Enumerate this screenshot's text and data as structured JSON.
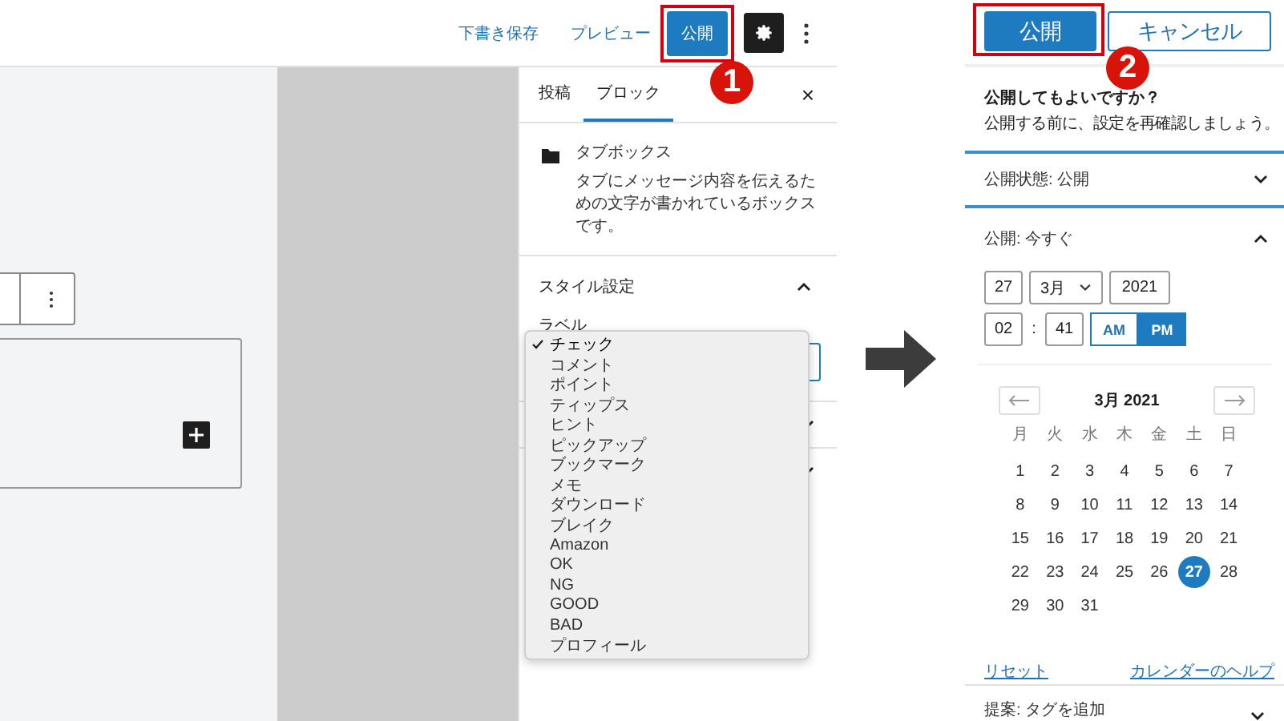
{
  "editor": {
    "header": {
      "save_draft": "下書き保存",
      "preview": "プレビュー",
      "publish": "公開",
      "callout": "1"
    },
    "sidebar": {
      "tabs": [
        {
          "label": "投稿",
          "selected": false
        },
        {
          "label": "ブロック",
          "selected": true
        }
      ],
      "close": "×",
      "block": {
        "name": "タブボックス",
        "description": "タブにメッセージ内容を伝えるための文字が書かれているボックスです。"
      },
      "style_section": {
        "title": "スタイル設定",
        "expanded": true,
        "field_label": "ラベル"
      },
      "dropdown": [
        {
          "label": "チェック",
          "selected": true
        },
        {
          "label": "コメント",
          "selected": false
        },
        {
          "label": "ポイント",
          "selected": false
        },
        {
          "label": "ティップス",
          "selected": false
        },
        {
          "label": "ヒント",
          "selected": false
        },
        {
          "label": "ピックアップ",
          "selected": false
        },
        {
          "label": "ブックマーク",
          "selected": false
        },
        {
          "label": "メモ",
          "selected": false
        },
        {
          "label": "ダウンロード",
          "selected": false
        },
        {
          "label": "ブレイク",
          "selected": false
        },
        {
          "label": "Amazon",
          "selected": false
        },
        {
          "label": "OK",
          "selected": false
        },
        {
          "label": "NG",
          "selected": false
        },
        {
          "label": "GOOD",
          "selected": false
        },
        {
          "label": "BAD",
          "selected": false
        },
        {
          "label": "プロフィール",
          "selected": false
        }
      ]
    }
  },
  "publish_panel": {
    "publish": "公開",
    "cancel": "キャンセル",
    "callout": "2",
    "heading": "公開してもよいですか？",
    "message": "公開する前に、設定を再確認しましょう。",
    "visibility": {
      "label": "公開状態: 公開",
      "expanded": false
    },
    "schedule": {
      "label": "公開: 今すぐ",
      "expanded": true,
      "day": "27",
      "month": "3月",
      "year": "2021",
      "hour": "02",
      "separator": ":",
      "minute": "41",
      "ampm": [
        {
          "label": "AM",
          "selected": false
        },
        {
          "label": "PM",
          "selected": true
        }
      ]
    },
    "calendar": {
      "title": "3月 2021",
      "weekdays": [
        "月",
        "火",
        "水",
        "木",
        "金",
        "土",
        "日"
      ],
      "days": [
        {
          "label": "1",
          "selected": false
        },
        {
          "label": "2",
          "selected": false
        },
        {
          "label": "3",
          "selected": false
        },
        {
          "label": "4",
          "selected": false
        },
        {
          "label": "5",
          "selected": false
        },
        {
          "label": "6",
          "selected": false
        },
        {
          "label": "7",
          "selected": false
        },
        {
          "label": "8",
          "selected": false
        },
        {
          "label": "9",
          "selected": false
        },
        {
          "label": "10",
          "selected": false
        },
        {
          "label": "11",
          "selected": false
        },
        {
          "label": "12",
          "selected": false
        },
        {
          "label": "13",
          "selected": false
        },
        {
          "label": "14",
          "selected": false
        },
        {
          "label": "15",
          "selected": false
        },
        {
          "label": "16",
          "selected": false
        },
        {
          "label": "17",
          "selected": false
        },
        {
          "label": "18",
          "selected": false
        },
        {
          "label": "19",
          "selected": false
        },
        {
          "label": "20",
          "selected": false
        },
        {
          "label": "21",
          "selected": false
        },
        {
          "label": "22",
          "selected": false
        },
        {
          "label": "23",
          "selected": false
        },
        {
          "label": "24",
          "selected": false
        },
        {
          "label": "25",
          "selected": false
        },
        {
          "label": "26",
          "selected": false
        },
        {
          "label": "27",
          "selected": true
        },
        {
          "label": "28",
          "selected": false
        },
        {
          "label": "29",
          "selected": false
        },
        {
          "label": "30",
          "selected": false
        },
        {
          "label": "31",
          "selected": false
        }
      ]
    },
    "reset": "リセット",
    "help": "カレンダーのヘルプ",
    "tags": "提案: タグを追加"
  }
}
